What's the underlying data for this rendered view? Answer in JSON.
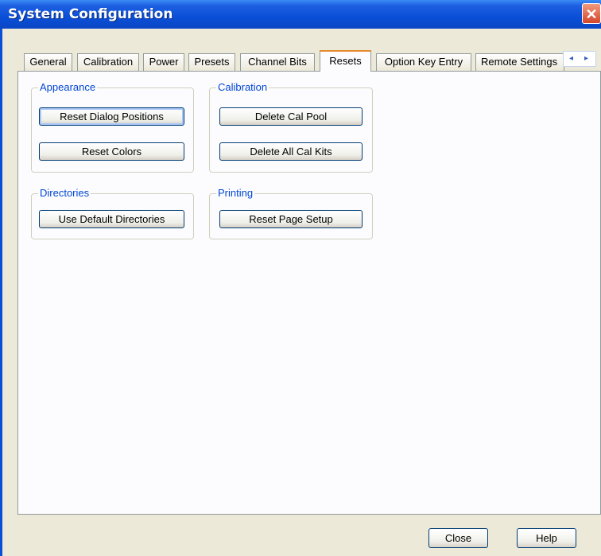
{
  "window": {
    "title": "System Configuration",
    "close_symbol": "✕"
  },
  "tabs": [
    {
      "label": "General"
    },
    {
      "label": "Calibration"
    },
    {
      "label": "Power"
    },
    {
      "label": "Presets"
    },
    {
      "label": "Channel Bits"
    },
    {
      "label": "Resets",
      "active": true
    },
    {
      "label": "Option Key Entry"
    },
    {
      "label": "Remote Settings"
    }
  ],
  "tab_scroll": {
    "left": "◂",
    "right": "▸"
  },
  "groups": {
    "appearance": {
      "title": "Appearance",
      "buttons": [
        "Reset Dialog Positions",
        "Reset Colors"
      ]
    },
    "calibration": {
      "title": "Calibration",
      "buttons": [
        "Delete Cal Pool",
        "Delete All Cal Kits"
      ]
    },
    "directories": {
      "title": "Directories",
      "buttons": [
        "Use Default Directories"
      ]
    },
    "printing": {
      "title": "Printing",
      "buttons": [
        "Reset Page Setup"
      ]
    }
  },
  "footer": {
    "close_label": "Close",
    "help_label": "Help"
  }
}
